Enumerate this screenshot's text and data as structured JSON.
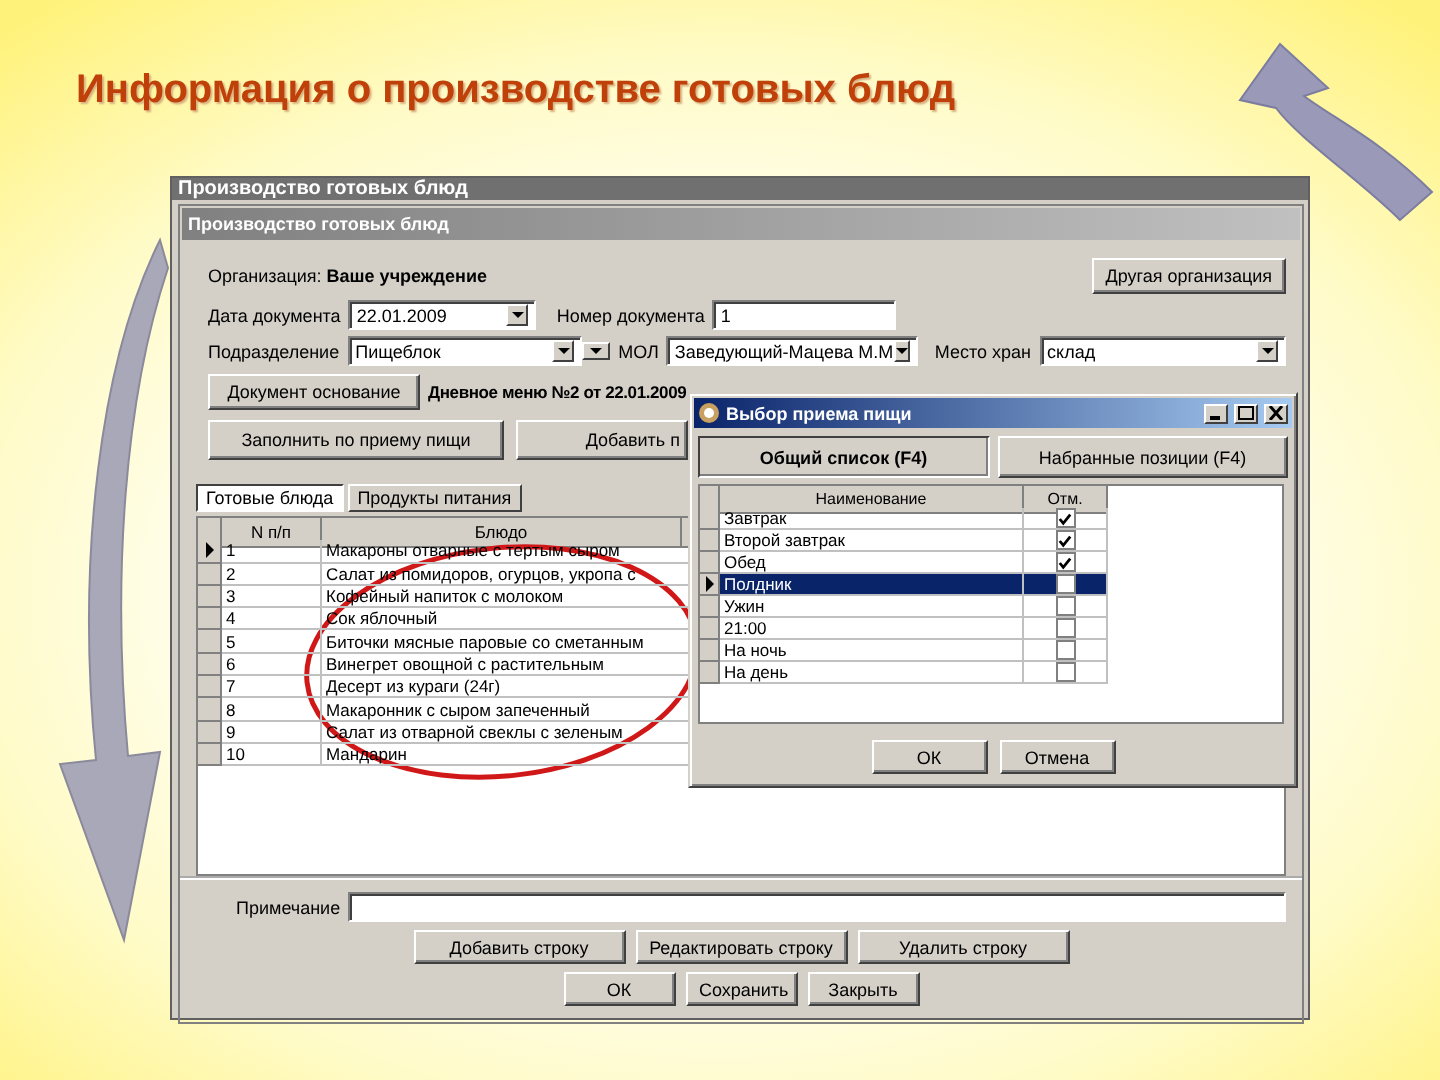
{
  "slide": {
    "title": "Информация о производстве готовых блюд"
  },
  "app_window": {
    "title": "Производство готовых блюд"
  },
  "window": {
    "title": "Производство готовых блюд"
  },
  "form": {
    "organization_label": "Организация:",
    "organization": "Ваше учреждение",
    "other_org_button": "Другая организация",
    "date_label": "Дата документа",
    "date": "22.01.2009",
    "number_label": "Номер документа",
    "number": "1",
    "department_label": "Подразделение",
    "department": "Пищеблок",
    "mol_label": "МОЛ",
    "mol": "Заведующий-Мацева М.М",
    "storage_label": "Место хран",
    "storage": "склад",
    "basis_button": "Документ основание",
    "basis": "Дневное меню №2 от 22.01.2009",
    "fill_button": "Заполнить по приему пищи",
    "add_button": "Добавить п"
  },
  "tabs": [
    {
      "label": "Готовые блюда",
      "selected": true
    },
    {
      "label": "Продукты питания",
      "selected": false
    }
  ],
  "table": {
    "columns": [
      "N п/п",
      "Блюдо"
    ],
    "rows": [
      {
        "n": "1",
        "dish": "Макароны отварные с тертым сыром",
        "selected": true
      },
      {
        "n": "2",
        "dish": "Салат из помидоров, огурцов, укропа с",
        "selected": false
      },
      {
        "n": "3",
        "dish": "Кофейный напиток с молоком",
        "selected": false
      },
      {
        "n": "4",
        "dish": "Сок яблочный",
        "selected": false
      },
      {
        "n": "5",
        "dish": "Биточки мясные паровые со сметанным",
        "selected": false
      },
      {
        "n": "6",
        "dish": "Винегрет овощной с растительным",
        "selected": false
      },
      {
        "n": "7",
        "dish": "Десерт из кураги (24г)",
        "selected": false
      },
      {
        "n": "8",
        "dish": "Макаронник с сыром запеченный",
        "selected": false
      },
      {
        "n": "9",
        "dish": "Салат из отварной свеклы с зеленым",
        "selected": false
      },
      {
        "n": "10",
        "dish": "Мандарин",
        "selected": false
      }
    ]
  },
  "note": {
    "label": "Примечание"
  },
  "row_buttons": [
    "Добавить строку",
    "Редактировать строку",
    "Удалить строку"
  ],
  "buttons": [
    "ОК",
    "Сохранить",
    "Закрыть"
  ],
  "dialog": {
    "title": "Выбор приема пищи",
    "tabs": [
      {
        "label": "Общий список (F4)",
        "selected": true
      },
      {
        "label": "Набранные позиции (F4)",
        "selected": false
      }
    ],
    "columns": [
      "Наименование",
      "Отм."
    ],
    "rows": [
      {
        "name": "Завтрак",
        "checked": true,
        "selected": false
      },
      {
        "name": "Второй завтрак",
        "checked": true,
        "selected": false
      },
      {
        "name": "Обед",
        "checked": true,
        "selected": false
      },
      {
        "name": "Полдник",
        "checked": false,
        "selected": true
      },
      {
        "name": "Ужин",
        "checked": false,
        "selected": false
      },
      {
        "name": "21:00",
        "checked": false,
        "selected": false
      },
      {
        "name": "На ночь",
        "checked": false,
        "selected": false
      },
      {
        "name": "На день",
        "checked": false,
        "selected": false
      }
    ],
    "buttons": [
      "ОК",
      "Отмена"
    ]
  }
}
